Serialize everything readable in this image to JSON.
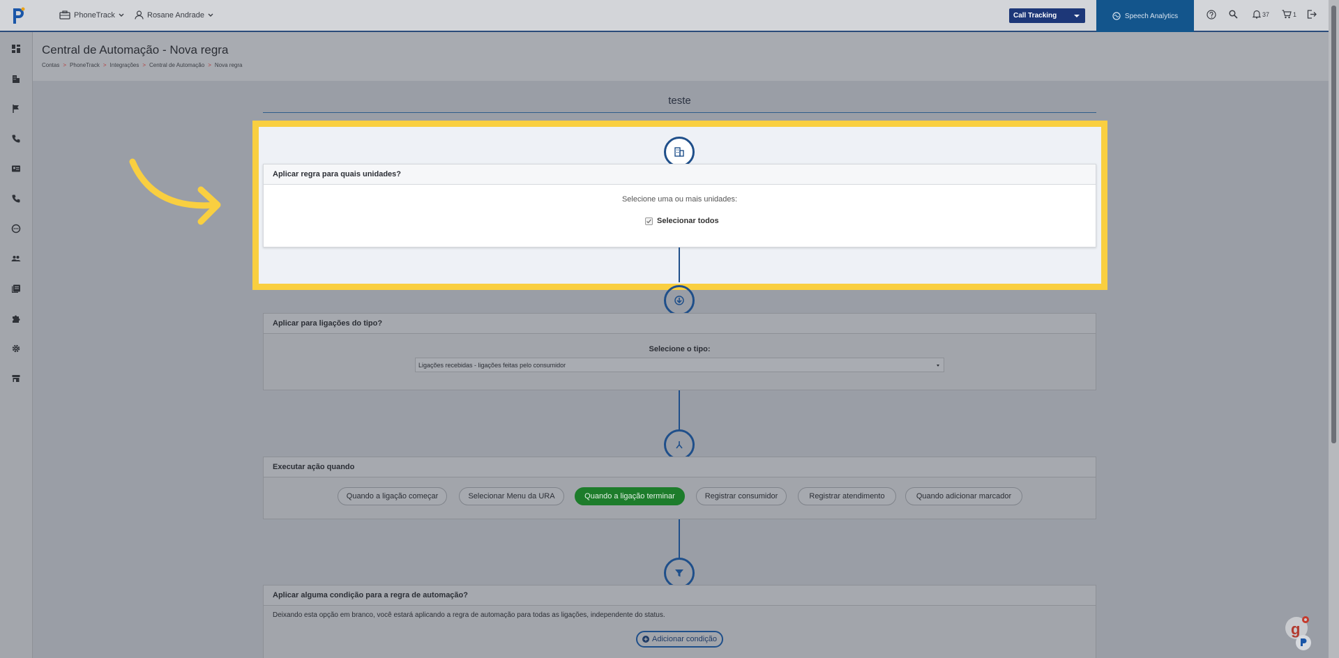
{
  "topbar": {
    "account_label": "PhoneTrack",
    "user_label": "Rosane Andrade",
    "product_select": "Call Tracking",
    "speech_label": "Speech Analytics",
    "notifications_count": "37",
    "cart_count": "1"
  },
  "header": {
    "title": "Central de Automação - Nova regra",
    "breadcrumb": [
      "Contas",
      "PhoneTrack",
      "Integrações",
      "Central de Automação",
      "Nova regra"
    ],
    "breadcrumb_sep": ">"
  },
  "rule": {
    "name": "teste"
  },
  "units_card": {
    "title": "Aplicar regra para quais unidades?",
    "prompt": "Selecione uma ou mais unidades:",
    "select_all_label": "Selecionar todos",
    "select_all_checked": true
  },
  "call_type_card": {
    "title": "Aplicar para ligações do tipo?",
    "prompt": "Selecione o tipo:",
    "selected_value": "Ligações recebidas - ligações feitas pelo consumidor"
  },
  "action_card": {
    "title": "Executar ação quando",
    "options": [
      {
        "label": "Quando a ligação começar",
        "active": false
      },
      {
        "label": "Selecionar Menu da URA",
        "active": false
      },
      {
        "label": "Quando a ligação terminar",
        "active": true
      },
      {
        "label": "Registrar consumidor",
        "active": false
      },
      {
        "label": "Registrar atendimento",
        "active": false
      },
      {
        "label": "Quando adicionar marcador",
        "active": false
      }
    ]
  },
  "condition_card": {
    "title": "Aplicar alguma condição para a regra de automação?",
    "description": "Deixando esta opção em branco, você estará aplicando a regra de automação para todas as ligações, independente do status.",
    "add_button": "Adicionar condição"
  },
  "colors": {
    "highlight": "#f9cf40",
    "primary": "#1f4f8a",
    "active_pill": "#1d7c2b",
    "product_select": "#1d3778",
    "speech": "#13558c"
  }
}
